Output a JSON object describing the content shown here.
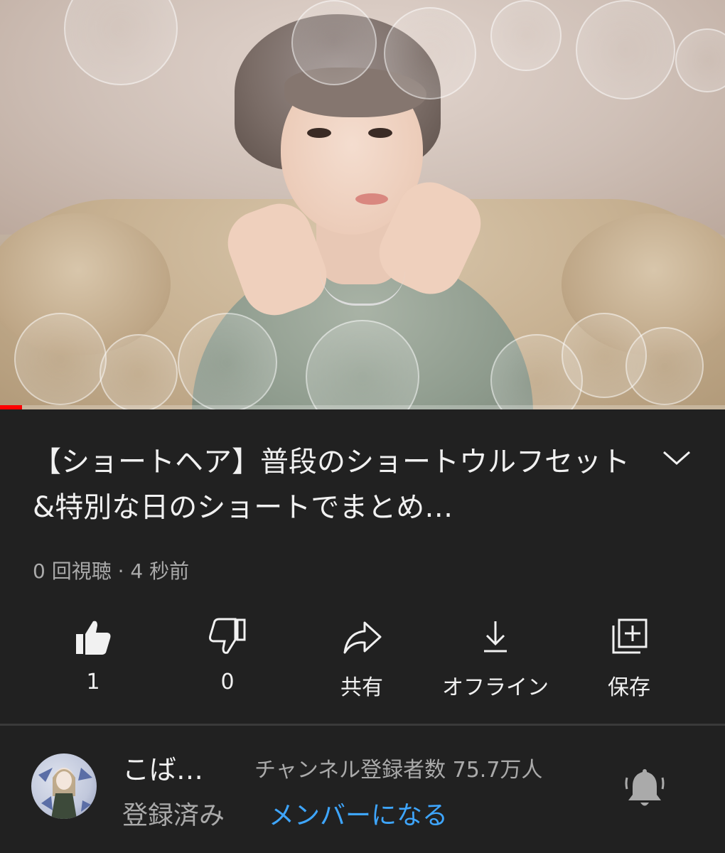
{
  "video": {
    "progress": 0.03,
    "colors": {
      "progress": "#ff0000"
    }
  },
  "info": {
    "title": "【ショートヘア】普段のショートウルフセット&特別な日のショートでまとめ…",
    "meta": "0 回視聴 · 4 秒前"
  },
  "actions": [
    {
      "icon": "thumbs-up-icon",
      "label": "1"
    },
    {
      "icon": "thumbs-down-icon",
      "label": "0"
    },
    {
      "icon": "share-icon",
      "label": "共有"
    },
    {
      "icon": "download-icon",
      "label": "オフライン"
    },
    {
      "icon": "save-playlist-icon",
      "label": "保存"
    }
  ],
  "channel": {
    "name": "こば…",
    "subscribers": "チャンネル登録者数 75.7万人",
    "subscribed_label": "登録済み",
    "join_label": "メンバーになる",
    "colors": {
      "join": "#3ea6ff"
    }
  }
}
